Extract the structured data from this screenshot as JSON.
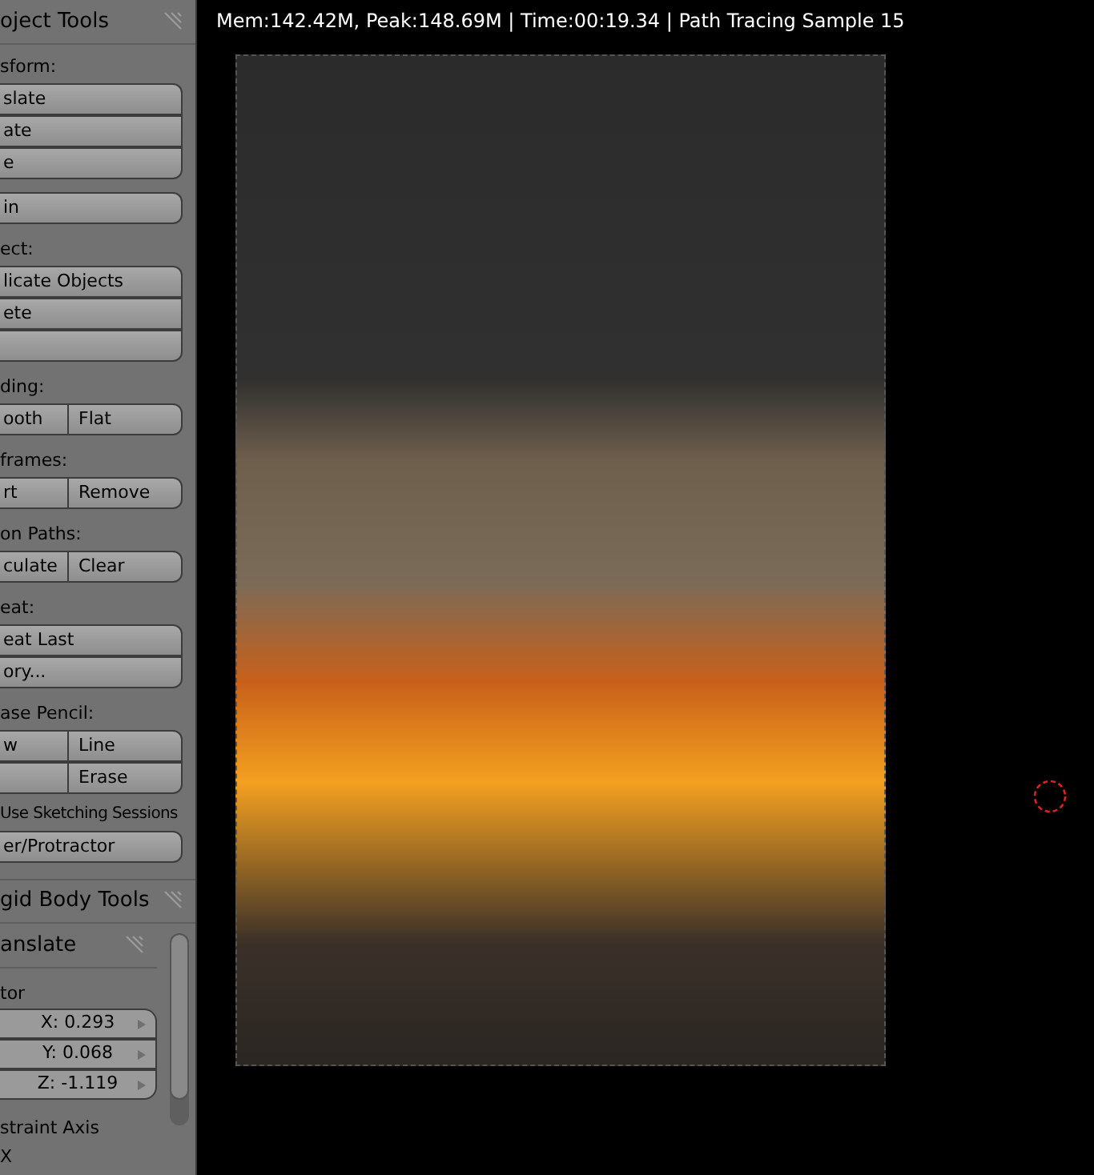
{
  "tool_panel": {
    "title": "oject Tools",
    "sections": [
      {
        "label": "sform:",
        "rows": [
          [
            "slate"
          ],
          [
            "ate"
          ],
          [
            "e"
          ]
        ]
      },
      {
        "rows": [
          [
            "in"
          ]
        ]
      },
      {
        "label": "ect:",
        "rows": [
          [
            "licate Objects"
          ],
          [
            "ete"
          ],
          [
            ""
          ]
        ]
      },
      {
        "label": "ding:",
        "rows": [
          [
            "ooth",
            "Flat"
          ]
        ]
      },
      {
        "label": "frames:",
        "rows": [
          [
            "rt",
            "Remove"
          ]
        ]
      },
      {
        "label": "on Paths:",
        "rows": [
          [
            "culate",
            "Clear"
          ]
        ]
      },
      {
        "label": "eat:",
        "rows": [
          [
            "eat Last"
          ],
          [
            "ory..."
          ]
        ]
      },
      {
        "label": "ase Pencil:",
        "rows": [
          [
            "w",
            "Line"
          ],
          [
            "",
            "Erase"
          ]
        ]
      }
    ],
    "sketching_checkbox": {
      "label": "Use Sketching Sessions"
    },
    "ruler_button": "er/Protractor"
  },
  "rigid_body_panel": {
    "title": "gid Body Tools"
  },
  "operator_panel": {
    "title": "anslate",
    "vector_label": "tor",
    "fields": [
      "X: 0.293",
      "Y: 0.068",
      "Z: -1.119"
    ],
    "constraint_label": "straint Axis",
    "axis_x": "X"
  },
  "viewport": {
    "status": "Mem:142.42M, Peak:148.69M | Time:00:19.34 | Path Tracing Sample 15"
  }
}
